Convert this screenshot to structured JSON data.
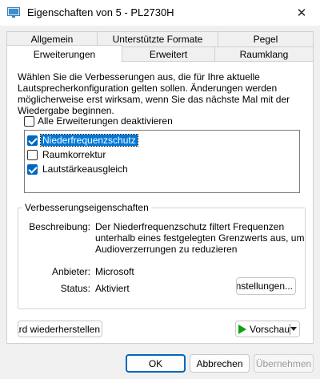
{
  "window": {
    "title": "Eigenschaften von 5 - PL2730H",
    "close_glyph": "✕"
  },
  "tabs": {
    "row_back": [
      {
        "label": "Allgemein"
      },
      {
        "label": "Unterstützte Formate"
      },
      {
        "label": "Pegel"
      }
    ],
    "row_front": [
      {
        "label": "Erweiterungen",
        "active": true
      },
      {
        "label": "Erweitert"
      },
      {
        "label": "Raumklang"
      }
    ]
  },
  "enhancements": {
    "description": "Wählen Sie die Verbesserungen aus, die für Ihre aktuelle Lautsprecherkonfiguration gelten sollen. Änderungen werden möglicherweise erst wirksam, wenn Sie das nächste Mal mit der Wiedergabe beginnen.",
    "disable_all": {
      "label": "Alle Erweiterungen deaktivieren",
      "checked": false
    },
    "items": [
      {
        "label": "Niederfrequenzschutz",
        "checked": true,
        "selected": true
      },
      {
        "label": "Raumkorrektur",
        "checked": false,
        "selected": false
      },
      {
        "label": "Lautstärkeausgleich",
        "checked": true,
        "selected": false
      }
    ]
  },
  "properties": {
    "group_title": "Verbesserungseigenschaften",
    "description_label": "Beschreibung:",
    "description_value_1": "Der Niederfrequenzschutz filtert Frequenzen",
    "description_value_2": "unterhalb eines festgelegten Grenzwerts aus, um",
    "description_value_3": "Audioverzerrungen zu reduzieren",
    "provider_label": "Anbieter:",
    "provider_value": "Microsoft",
    "status_label": "Status:",
    "status_value": "Aktiviert",
    "settings_button": "Einstellungen..."
  },
  "actions": {
    "restore_defaults": "Standard wiederherstellen",
    "preview": "Vorschau"
  },
  "footer": {
    "ok": "OK",
    "cancel": "Abbrechen",
    "apply": "Übernehmen"
  },
  "colors": {
    "accent": "#0067c0",
    "selection": "#0078d7",
    "preview_icon": "#10a010"
  }
}
